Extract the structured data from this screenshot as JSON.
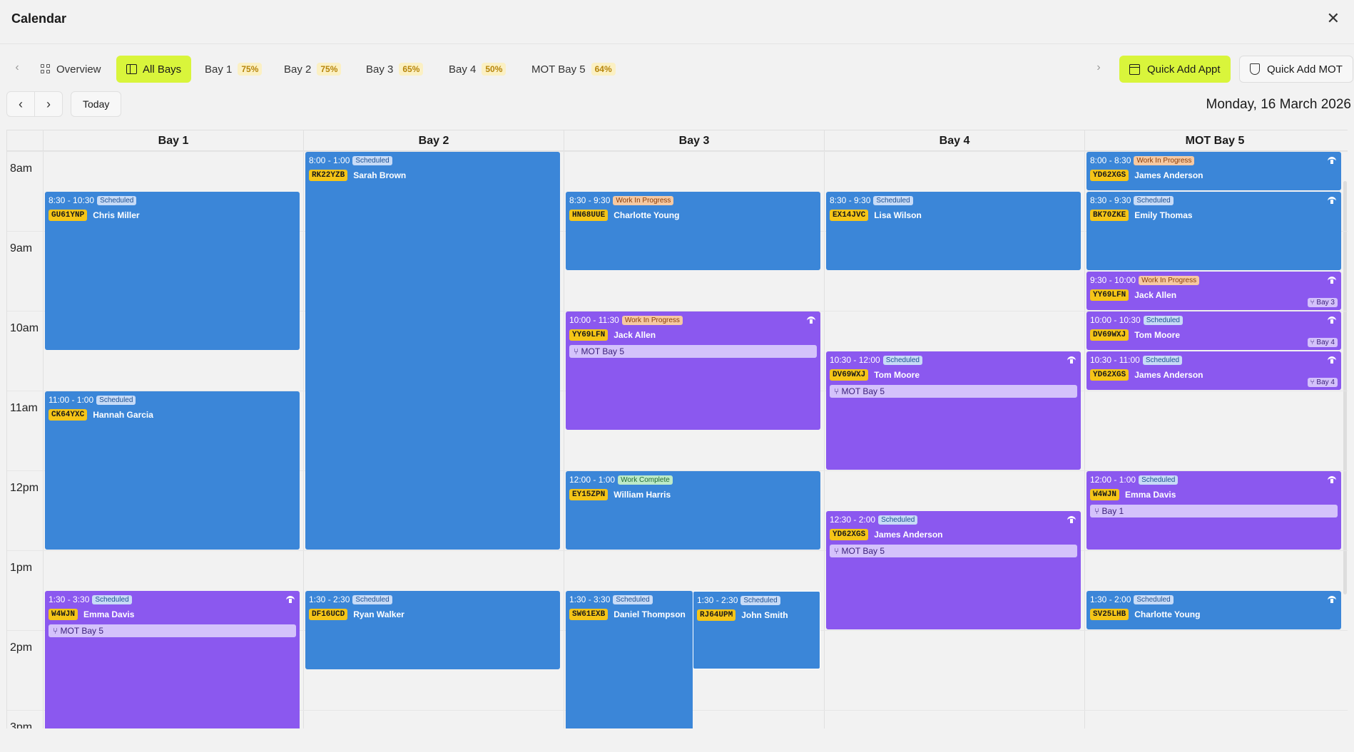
{
  "window": {
    "title": "Calendar"
  },
  "tabs": [
    {
      "label": "Overview",
      "pct": ""
    },
    {
      "label": "All Bays",
      "pct": "",
      "active": true
    },
    {
      "label": "Bay 1",
      "pct": "75%"
    },
    {
      "label": "Bay 2",
      "pct": "75%"
    },
    {
      "label": "Bay 3",
      "pct": "65%"
    },
    {
      "label": "Bay 4",
      "pct": "50%"
    },
    {
      "label": "MOT Bay 5",
      "pct": "64%"
    }
  ],
  "actions": {
    "quick_add_appt": "Quick Add Appt",
    "quick_add_mot": "Quick Add MOT"
  },
  "nav": {
    "today": "Today",
    "date": "Monday, 16 March 2026"
  },
  "columns": [
    "Bay 1",
    "Bay 2",
    "Bay 3",
    "Bay 4",
    "MOT Bay 5"
  ],
  "hours": [
    "8am",
    "9am",
    "10am",
    "11am",
    "12pm",
    "1pm",
    "2pm",
    "3pm"
  ],
  "appointments": [
    {
      "bay": "Bay 1",
      "time": "8:30 - 10:30",
      "status": "Scheduled",
      "plate": "GU61YNP",
      "customer": "Chris Miller",
      "color": "blue"
    },
    {
      "bay": "Bay 1",
      "time": "11:00 - 1:00",
      "status": "Scheduled",
      "plate": "CK64YXC",
      "customer": "Hannah Garcia",
      "color": "blue"
    },
    {
      "bay": "Bay 1",
      "time": "1:30 - 3:30",
      "status": "Scheduled",
      "plate": "W4WJN",
      "customer": "Emma Davis",
      "color": "purple",
      "link": "MOT Bay 5",
      "mot": true
    },
    {
      "bay": "Bay 2",
      "time": "8:00 - 1:00",
      "status": "Scheduled",
      "plate": "RK22YZB",
      "customer": "Sarah Brown",
      "color": "blue"
    },
    {
      "bay": "Bay 2",
      "time": "1:30 - 2:30",
      "status": "Scheduled",
      "plate": "DF16UCD",
      "customer": "Ryan Walker",
      "color": "blue"
    },
    {
      "bay": "Bay 3",
      "time": "8:30 - 9:30",
      "status": "Work In Progress",
      "plate": "HN68UUE",
      "customer": "Charlotte Young",
      "color": "blue"
    },
    {
      "bay": "Bay 3",
      "time": "10:00 - 11:30",
      "status": "Work In Progress",
      "plate": "YY69LFN",
      "customer": "Jack Allen",
      "color": "purple",
      "link": "MOT Bay 5",
      "mot": true
    },
    {
      "bay": "Bay 3",
      "time": "12:00 - 1:00",
      "status": "Work Complete",
      "plate": "EY15ZPN",
      "customer": "William Harris",
      "color": "blue"
    },
    {
      "bay": "Bay 3",
      "time": "1:30 - 3:30",
      "status": "Scheduled",
      "plate": "SW61EXB",
      "customer": "Daniel Thompson",
      "color": "blue"
    },
    {
      "bay": "Bay 3",
      "time": "1:30 - 2:30",
      "status": "Scheduled",
      "plate": "RJ64UPM",
      "customer": "John Smith",
      "color": "blue"
    },
    {
      "bay": "Bay 4",
      "time": "8:30 - 9:30",
      "status": "Scheduled",
      "plate": "EX14JVC",
      "customer": "Lisa Wilson",
      "color": "blue"
    },
    {
      "bay": "Bay 4",
      "time": "10:30 - 12:00",
      "status": "Scheduled",
      "plate": "DV69WXJ",
      "customer": "Tom Moore",
      "color": "purple",
      "link": "MOT Bay 5",
      "mot": true
    },
    {
      "bay": "Bay 4",
      "time": "12:30 - 2:00",
      "status": "Scheduled",
      "plate": "YD62XGS",
      "customer": "James Anderson",
      "color": "purple",
      "link": "MOT Bay 5",
      "mot": true
    },
    {
      "bay": "MOT Bay 5",
      "time": "8:00 - 8:30",
      "status": "Work In Progress",
      "plate": "YD62XGS",
      "customer": "James Anderson",
      "color": "blue",
      "mot": true
    },
    {
      "bay": "MOT Bay 5",
      "time": "8:30 - 9:30",
      "status": "Scheduled",
      "plate": "BK70ZKE",
      "customer": "Emily Thomas",
      "color": "blue",
      "mot": true
    },
    {
      "bay": "MOT Bay 5",
      "time": "9:30 - 10:00",
      "status": "Work In Progress",
      "plate": "YY69LFN",
      "customer": "Jack Allen",
      "color": "purple",
      "tag": "Bay 3",
      "mot": true
    },
    {
      "bay": "MOT Bay 5",
      "time": "10:00 - 10:30",
      "status": "Scheduled",
      "plate": "DV69WXJ",
      "customer": "Tom Moore",
      "color": "purple",
      "tag": "Bay 4",
      "mot": true
    },
    {
      "bay": "MOT Bay 5",
      "time": "10:30 - 11:00",
      "status": "Scheduled",
      "plate": "YD62XGS",
      "customer": "James Anderson",
      "color": "purple",
      "tag": "Bay 4",
      "mot": true
    },
    {
      "bay": "MOT Bay 5",
      "time": "12:00 - 1:00",
      "status": "Scheduled",
      "plate": "W4WJN",
      "customer": "Emma Davis",
      "color": "purple",
      "link": "Bay 1",
      "mot": true
    },
    {
      "bay": "MOT Bay 5",
      "time": "1:30 - 2:00",
      "status": "Scheduled",
      "plate": "SV25LHB",
      "customer": "Charlotte Young",
      "color": "blue",
      "mot": true
    }
  ]
}
